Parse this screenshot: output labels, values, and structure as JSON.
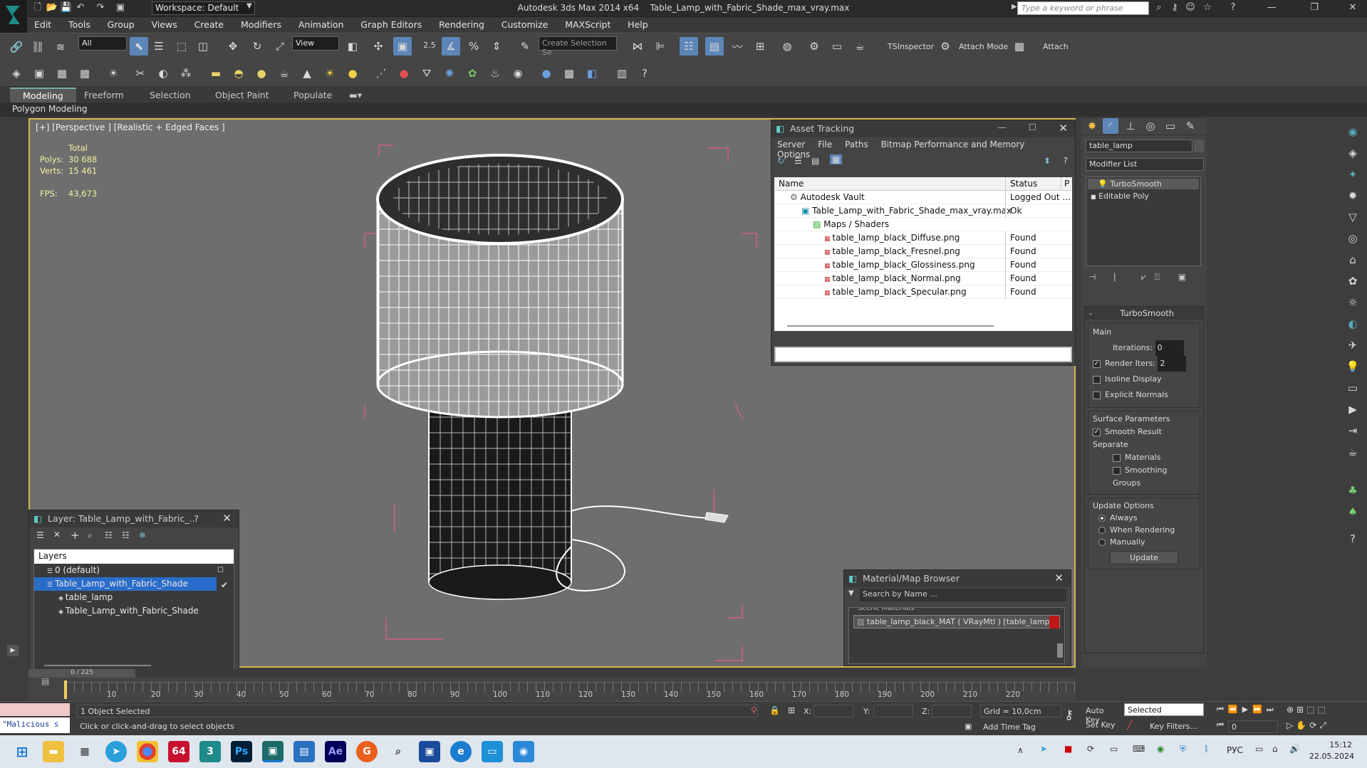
{
  "app": {
    "title": "Autodesk 3ds Max  2014 x64",
    "file": "Table_Lamp_with_Fabric_Shade_max_vray.max",
    "workspace": "Workspace: Default",
    "search_placeholder": "Type a keyword or phrase"
  },
  "menu": [
    "Edit",
    "Tools",
    "Group",
    "Views",
    "Create",
    "Modifiers",
    "Animation",
    "Graph Editors",
    "Rendering",
    "Customize",
    "MAXScript",
    "Help"
  ],
  "toolbar": {
    "filter": "All",
    "refcoord": "View",
    "selset_placeholder": "Create Selection Se",
    "snap_value": "2.5",
    "tsinspector": "TSInspector",
    "attach_mode": "Attach Mode",
    "attach": "Attach"
  },
  "ribbon": {
    "tabs": [
      "Modeling",
      "Freeform",
      "Selection",
      "Object Paint",
      "Populate"
    ],
    "sub": "Polygon Modeling"
  },
  "viewport": {
    "label": "[+] [Perspective ] [Realistic + Edged Faces ]",
    "stats_total": "Total",
    "polys_label": "Polys:",
    "polys": "30 688",
    "verts_label": "Verts:",
    "verts": "15 461",
    "fps_label": "FPS:",
    "fps": "43,673"
  },
  "asset_tracking": {
    "title": "Asset Tracking",
    "menu": [
      "Server",
      "File",
      "Paths",
      "Bitmap Performance and Memory",
      "Options"
    ],
    "col_name": "Name",
    "col_status": "Status",
    "col_p": "P",
    "rows": [
      {
        "name": "Autodesk Vault",
        "status": "Logged Out ..."
      },
      {
        "name": "Table_Lamp_with_Fabric_Shade_max_vray.max",
        "status": "Ok"
      },
      {
        "name": "Maps / Shaders",
        "status": ""
      },
      {
        "name": "table_lamp_black_Diffuse.png",
        "status": "Found"
      },
      {
        "name": "table_lamp_black_Fresnel.png",
        "status": "Found"
      },
      {
        "name": "table_lamp_black_Glossiness.png",
        "status": "Found"
      },
      {
        "name": "table_lamp_black_Normal.png",
        "status": "Found"
      },
      {
        "name": "table_lamp_black_Specular.png",
        "status": "Found"
      }
    ]
  },
  "layer_panel": {
    "title": "Layer: Table_Lamp_with_Fabric_...",
    "help": "?",
    "header": "Layers",
    "rows": [
      "0 (default)",
      "Table_Lamp_with_Fabric_Shade",
      "table_lamp",
      "Table_Lamp_with_Fabric_Shade"
    ]
  },
  "material_browser": {
    "title": "Material/Map Browser",
    "search_placeholder": "Search by Name ...",
    "section": "Scene Materials",
    "item": "table_lamp_black_MAT  ( VRayMtl )  [table_lamp]"
  },
  "command_panel": {
    "object_name": "table_lamp",
    "modifier_list": "Modifier List",
    "stack": [
      "TurboSmooth",
      "Editable Poly"
    ],
    "rollout_title": "TurboSmooth",
    "main": "Main",
    "iterations_label": "Iterations:",
    "iterations": "0",
    "render_iters_label": "Render Iters:",
    "render_iters": "2",
    "isoline": "Isoline Display",
    "explicit": "Explicit Normals",
    "surface": "Surface Parameters",
    "smooth_result": "Smooth Result",
    "separate": "Separate",
    "materials": "Materials",
    "smoothing_groups": "Smoothing Groups",
    "update_options": "Update Options",
    "always": "Always",
    "when_rendering": "When Rendering",
    "manually": "Manually",
    "update": "Update"
  },
  "timeline": {
    "frame": "0 / 225",
    "ticks": [
      "10",
      "20",
      "30",
      "40",
      "50",
      "60",
      "70",
      "80",
      "90",
      "100",
      "110",
      "120",
      "130",
      "140",
      "150",
      "160",
      "170",
      "180",
      "190",
      "200",
      "210",
      "220"
    ]
  },
  "status": {
    "maxscript": "\"Malicious s",
    "selected": "1 Object Selected",
    "prompt": "Click or click-and-drag to select objects",
    "x_label": "X:",
    "y_label": "Y:",
    "z_label": "Z:",
    "grid": "Grid = 10,0cm",
    "add_time_tag": "Add Time Tag",
    "auto_key": "Auto Key",
    "set_key": "Set Key",
    "selected_dd": "Selected",
    "key_filters": "Key Filters...",
    "frame_value": "0"
  },
  "taskbar": {
    "lang": "РУС",
    "time": "15:12",
    "date": "22.05.2024",
    "badge": "64"
  }
}
